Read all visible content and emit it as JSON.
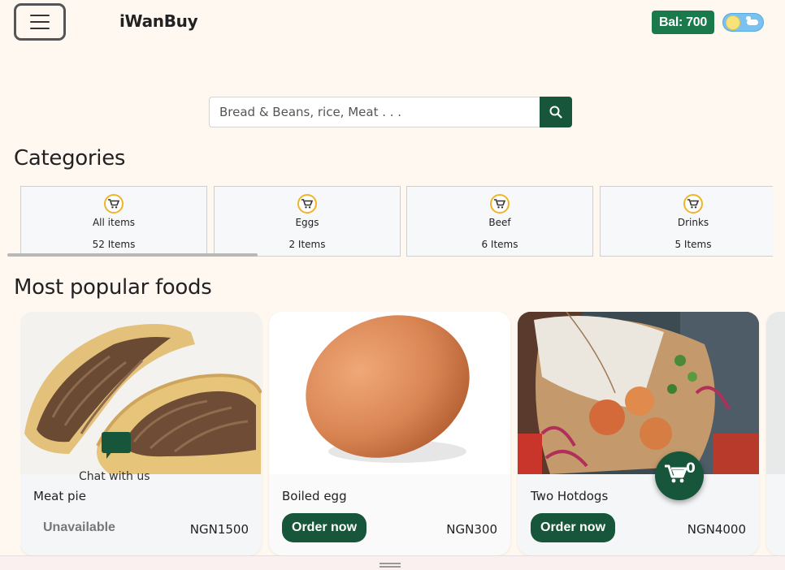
{
  "header": {
    "brand": "iWanBuy",
    "balance": "Bal: 700",
    "menu_icon": "hamburger-icon",
    "theme_icon": "sun-cloud-toggle-icon"
  },
  "search": {
    "placeholder": "Bread & Beans, rice, Meat . . .",
    "button_icon": "search-icon"
  },
  "categories": {
    "title": "Categories",
    "items": [
      {
        "name": "All items",
        "count": "52 Items",
        "icon": "cart-icon"
      },
      {
        "name": "Eggs",
        "count": "2 Items",
        "icon": "cart-icon"
      },
      {
        "name": "Beef",
        "count": "6 Items",
        "icon": "cart-icon"
      },
      {
        "name": "Drinks",
        "count": "5 Items",
        "icon": "cart-icon"
      }
    ]
  },
  "popular": {
    "title": "Most popular foods",
    "items": [
      {
        "name": "Meat pie",
        "price": "NGN1500",
        "action": "Unavailable"
      },
      {
        "name": "Boiled egg",
        "price": "NGN300",
        "action": "Order now"
      },
      {
        "name": "Two Hotdogs",
        "price": "NGN4000",
        "action": "Order now"
      }
    ]
  },
  "chat": {
    "label": "Chat with us",
    "icon": "chat-bubble-icon"
  },
  "cart": {
    "count": "0",
    "icon": "cart-icon"
  },
  "colors": {
    "primary": "#17563a",
    "balance_bg": "#1a7a4c",
    "background": "#fff8f1",
    "category_icon_ring": "#f0b429"
  }
}
